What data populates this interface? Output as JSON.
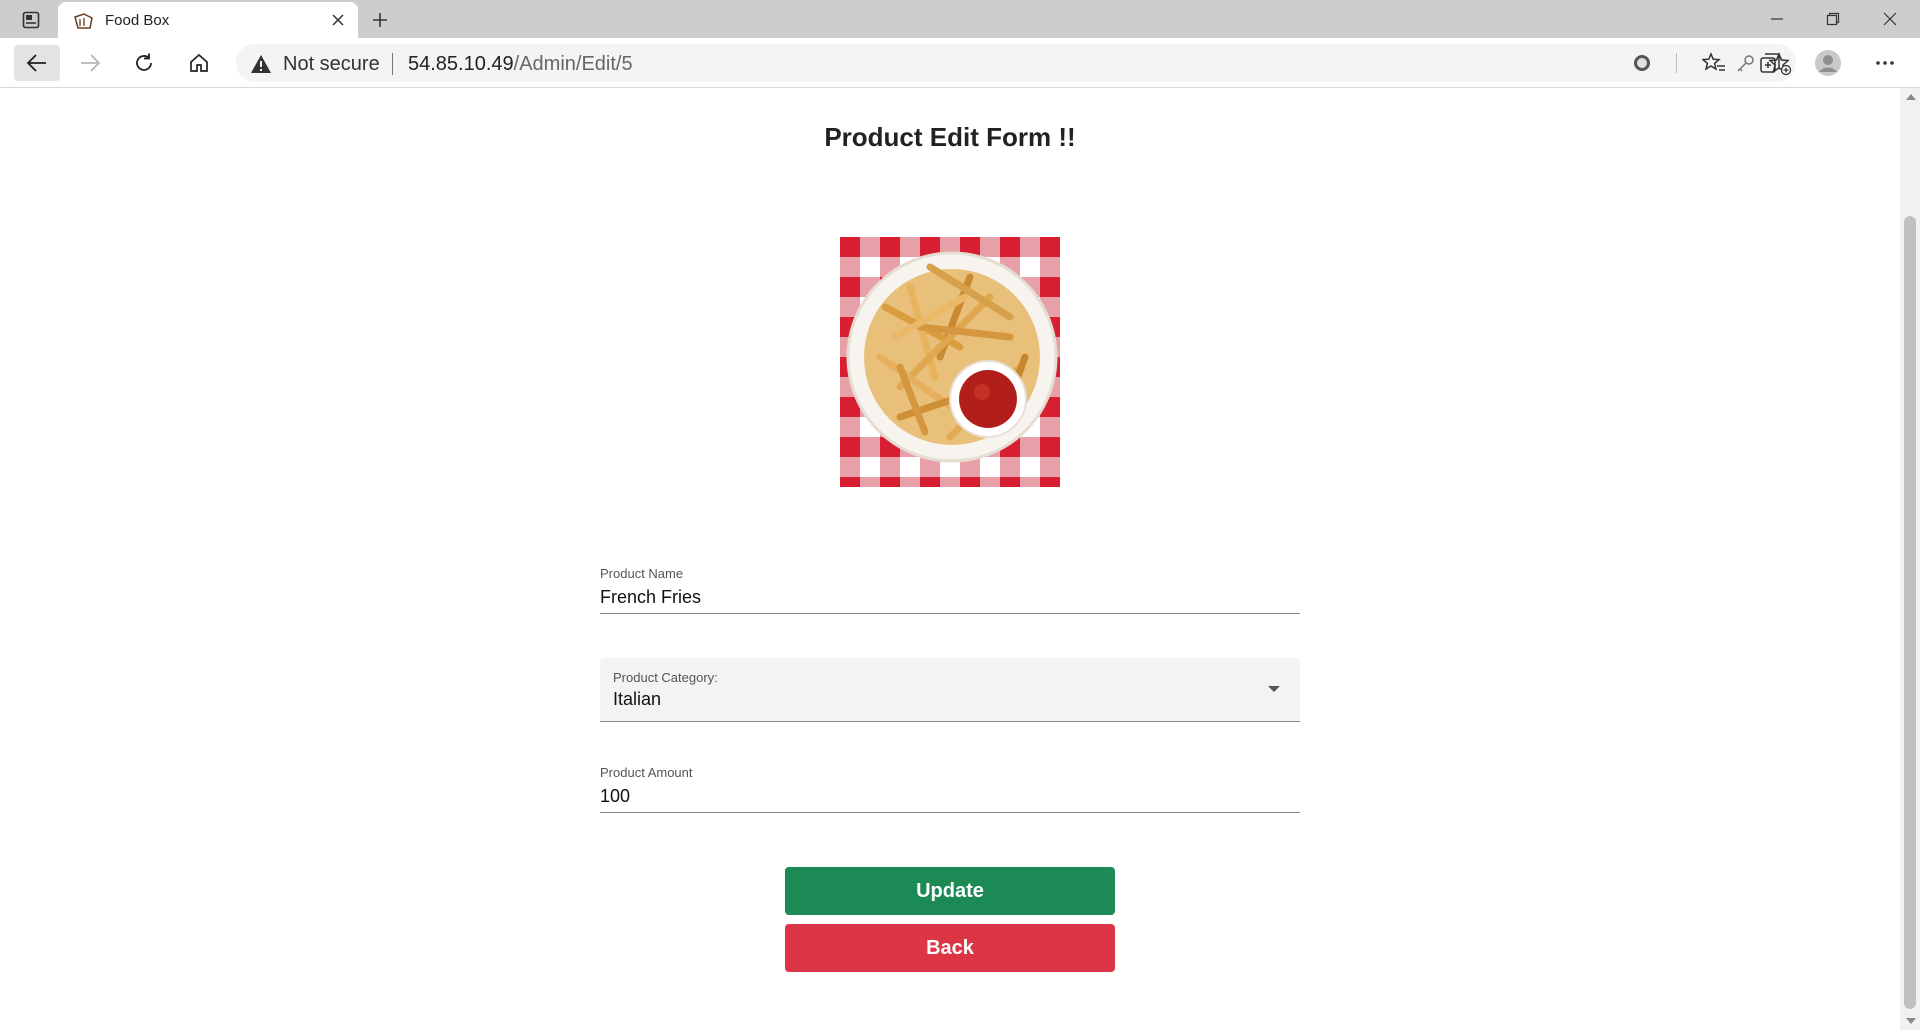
{
  "browser": {
    "tab_title": "Food Box",
    "address": {
      "security_label": "Not secure",
      "host": "54.85.10.49",
      "path": "/Admin/Edit/5"
    }
  },
  "page": {
    "title": "Product Edit Form !!",
    "image_alt": "French fries with ketchup"
  },
  "form": {
    "name": {
      "label": "Product Name",
      "value": "French Fries"
    },
    "category": {
      "label": "Product Category:",
      "value": "Italian"
    },
    "amount": {
      "label": "Product Amount",
      "value": "100"
    }
  },
  "buttons": {
    "update": "Update",
    "back": "Back"
  },
  "colors": {
    "update_button": "#1b8a55",
    "back_button": "#dc3545"
  }
}
